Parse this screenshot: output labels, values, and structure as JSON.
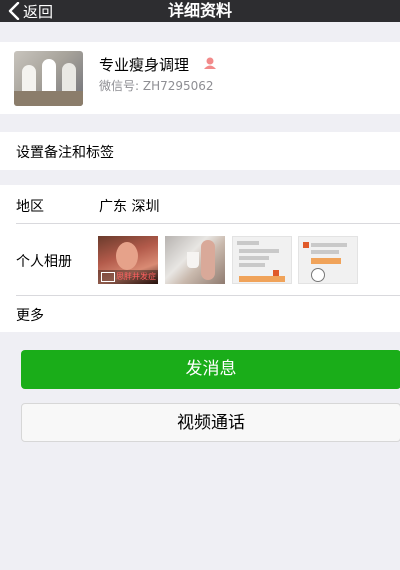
{
  "navbar": {
    "back_label": "返回",
    "title": "详细资料"
  },
  "profile": {
    "name": "专业瘦身调理",
    "wechat_id": "微信号:  ZH7295062"
  },
  "remark_row": {
    "label": "设置备注和标签"
  },
  "info": {
    "region_label": "地区",
    "region_value": "广东  深圳",
    "album_label": "个人相册",
    "album_video_text": "思胖并发症",
    "more_label": "更多"
  },
  "actions": {
    "send_message": "发消息",
    "video_call": "视频通话"
  },
  "colors": {
    "navbar": "#2d2d30",
    "background": "#efeff4",
    "primary_green": "#1aad19"
  }
}
